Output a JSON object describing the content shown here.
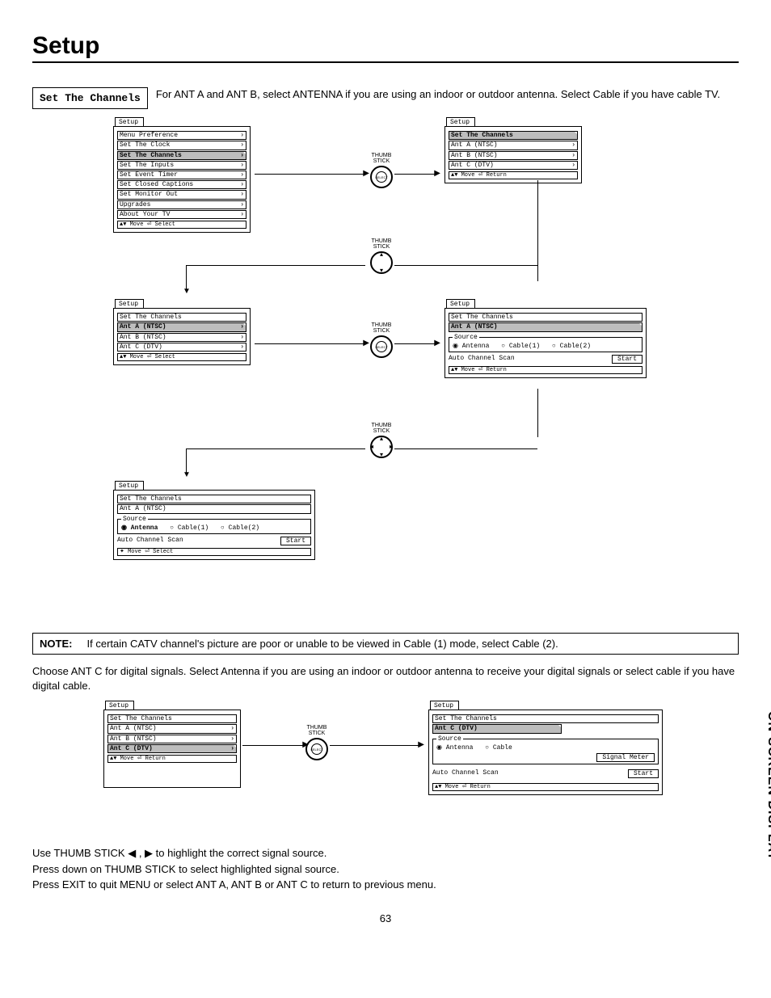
{
  "page": {
    "title": "Setup",
    "number": "63",
    "side_label": "ON-SCREEN DISPLAY"
  },
  "section": {
    "label": "Set The Channels",
    "intro": "For ANT A and ANT B, select ANTENNA if you are using an indoor or outdoor antenna.  Select Cable if you have cable TV."
  },
  "thumb": "THUMB\nSTICK",
  "select_lbl": "SELECT",
  "note": {
    "label": "NOTE:",
    "text": "If certain CATV channel's picture are poor or unable to be viewed in Cable (1) mode, select Cable (2)."
  },
  "para2": "Choose ANT C for digital signals.  Select Antenna if you are using an indoor or outdoor antenna to receive your digital signals or select cable if you have digital cable.",
  "instr1": "Use THUMB STICK ◀ , ▶ to highlight the correct signal source.",
  "instr2": "Press down on THUMB STICK to select highlighted signal source.",
  "instr3": "Press EXIT to quit MENU or select ANT A, ANT B or ANT C to return to previous menu.",
  "menu1": {
    "tab": "Setup",
    "items": [
      "Menu Preference",
      "Set The Clock",
      "Set The Channels",
      "Set The Inputs",
      "Set Event Timer",
      "Set Closed Captions",
      "Set Monitor Out",
      "Upgrades",
      "About Your TV"
    ],
    "hi": 2,
    "footer": "▲▼ Move  ⏎ Select"
  },
  "menu2": {
    "tab": "Setup",
    "crumb": "Set The Channels",
    "items": [
      "Ant A (NTSC)",
      "Ant B (NTSC)",
      "Ant C (DTV)"
    ],
    "footer": "▲▼ Move  ⏎ Return"
  },
  "menu3": {
    "tab": "Setup",
    "crumb": "Set The Channels",
    "items": [
      "Ant A (NTSC)",
      "Ant B (NTSC)",
      "Ant C (DTV)"
    ],
    "hi": 0,
    "footer": "▲▼ Move  ⏎ Select"
  },
  "menu4": {
    "tab": "Setup",
    "crumb": "Set The Channels",
    "sub": "Ant A (NTSC)",
    "source_legend": "Source",
    "radios": [
      "Antenna",
      "Cable(1)",
      "Cable(2)"
    ],
    "scan": "Auto Channel Scan",
    "start": "Start",
    "footer": "▲▼ Move  ⏎ Return"
  },
  "menu5": {
    "tab": "Setup",
    "crumb": "Set The Channels",
    "sub": "Ant A (NTSC)",
    "source_legend": "Source",
    "radios": [
      "Antenna",
      "Cable(1)",
      "Cable(2)"
    ],
    "radio_sel": 0,
    "scan": "Auto Channel Scan",
    "start": "Start",
    "footer": "✦ Move  ⏎ Select"
  },
  "menu6": {
    "tab": "Setup",
    "crumb": "Set The Channels",
    "items": [
      "Ant A (NTSC)",
      "Ant B (NTSC)",
      "Ant C (DTV)"
    ],
    "hi": 2,
    "footer": "▲▼ Move  ⏎ Return"
  },
  "menu7": {
    "tab": "Setup",
    "crumb": "Set The Channels",
    "sub": "Ant C (DTV)",
    "source_legend": "Source",
    "radios": [
      "Antenna",
      "Cable"
    ],
    "radio_sel": 0,
    "signal": "Signal Meter",
    "scan": "Auto Channel Scan",
    "start": "Start",
    "footer": "▲▼ Move  ⏎ Return"
  }
}
